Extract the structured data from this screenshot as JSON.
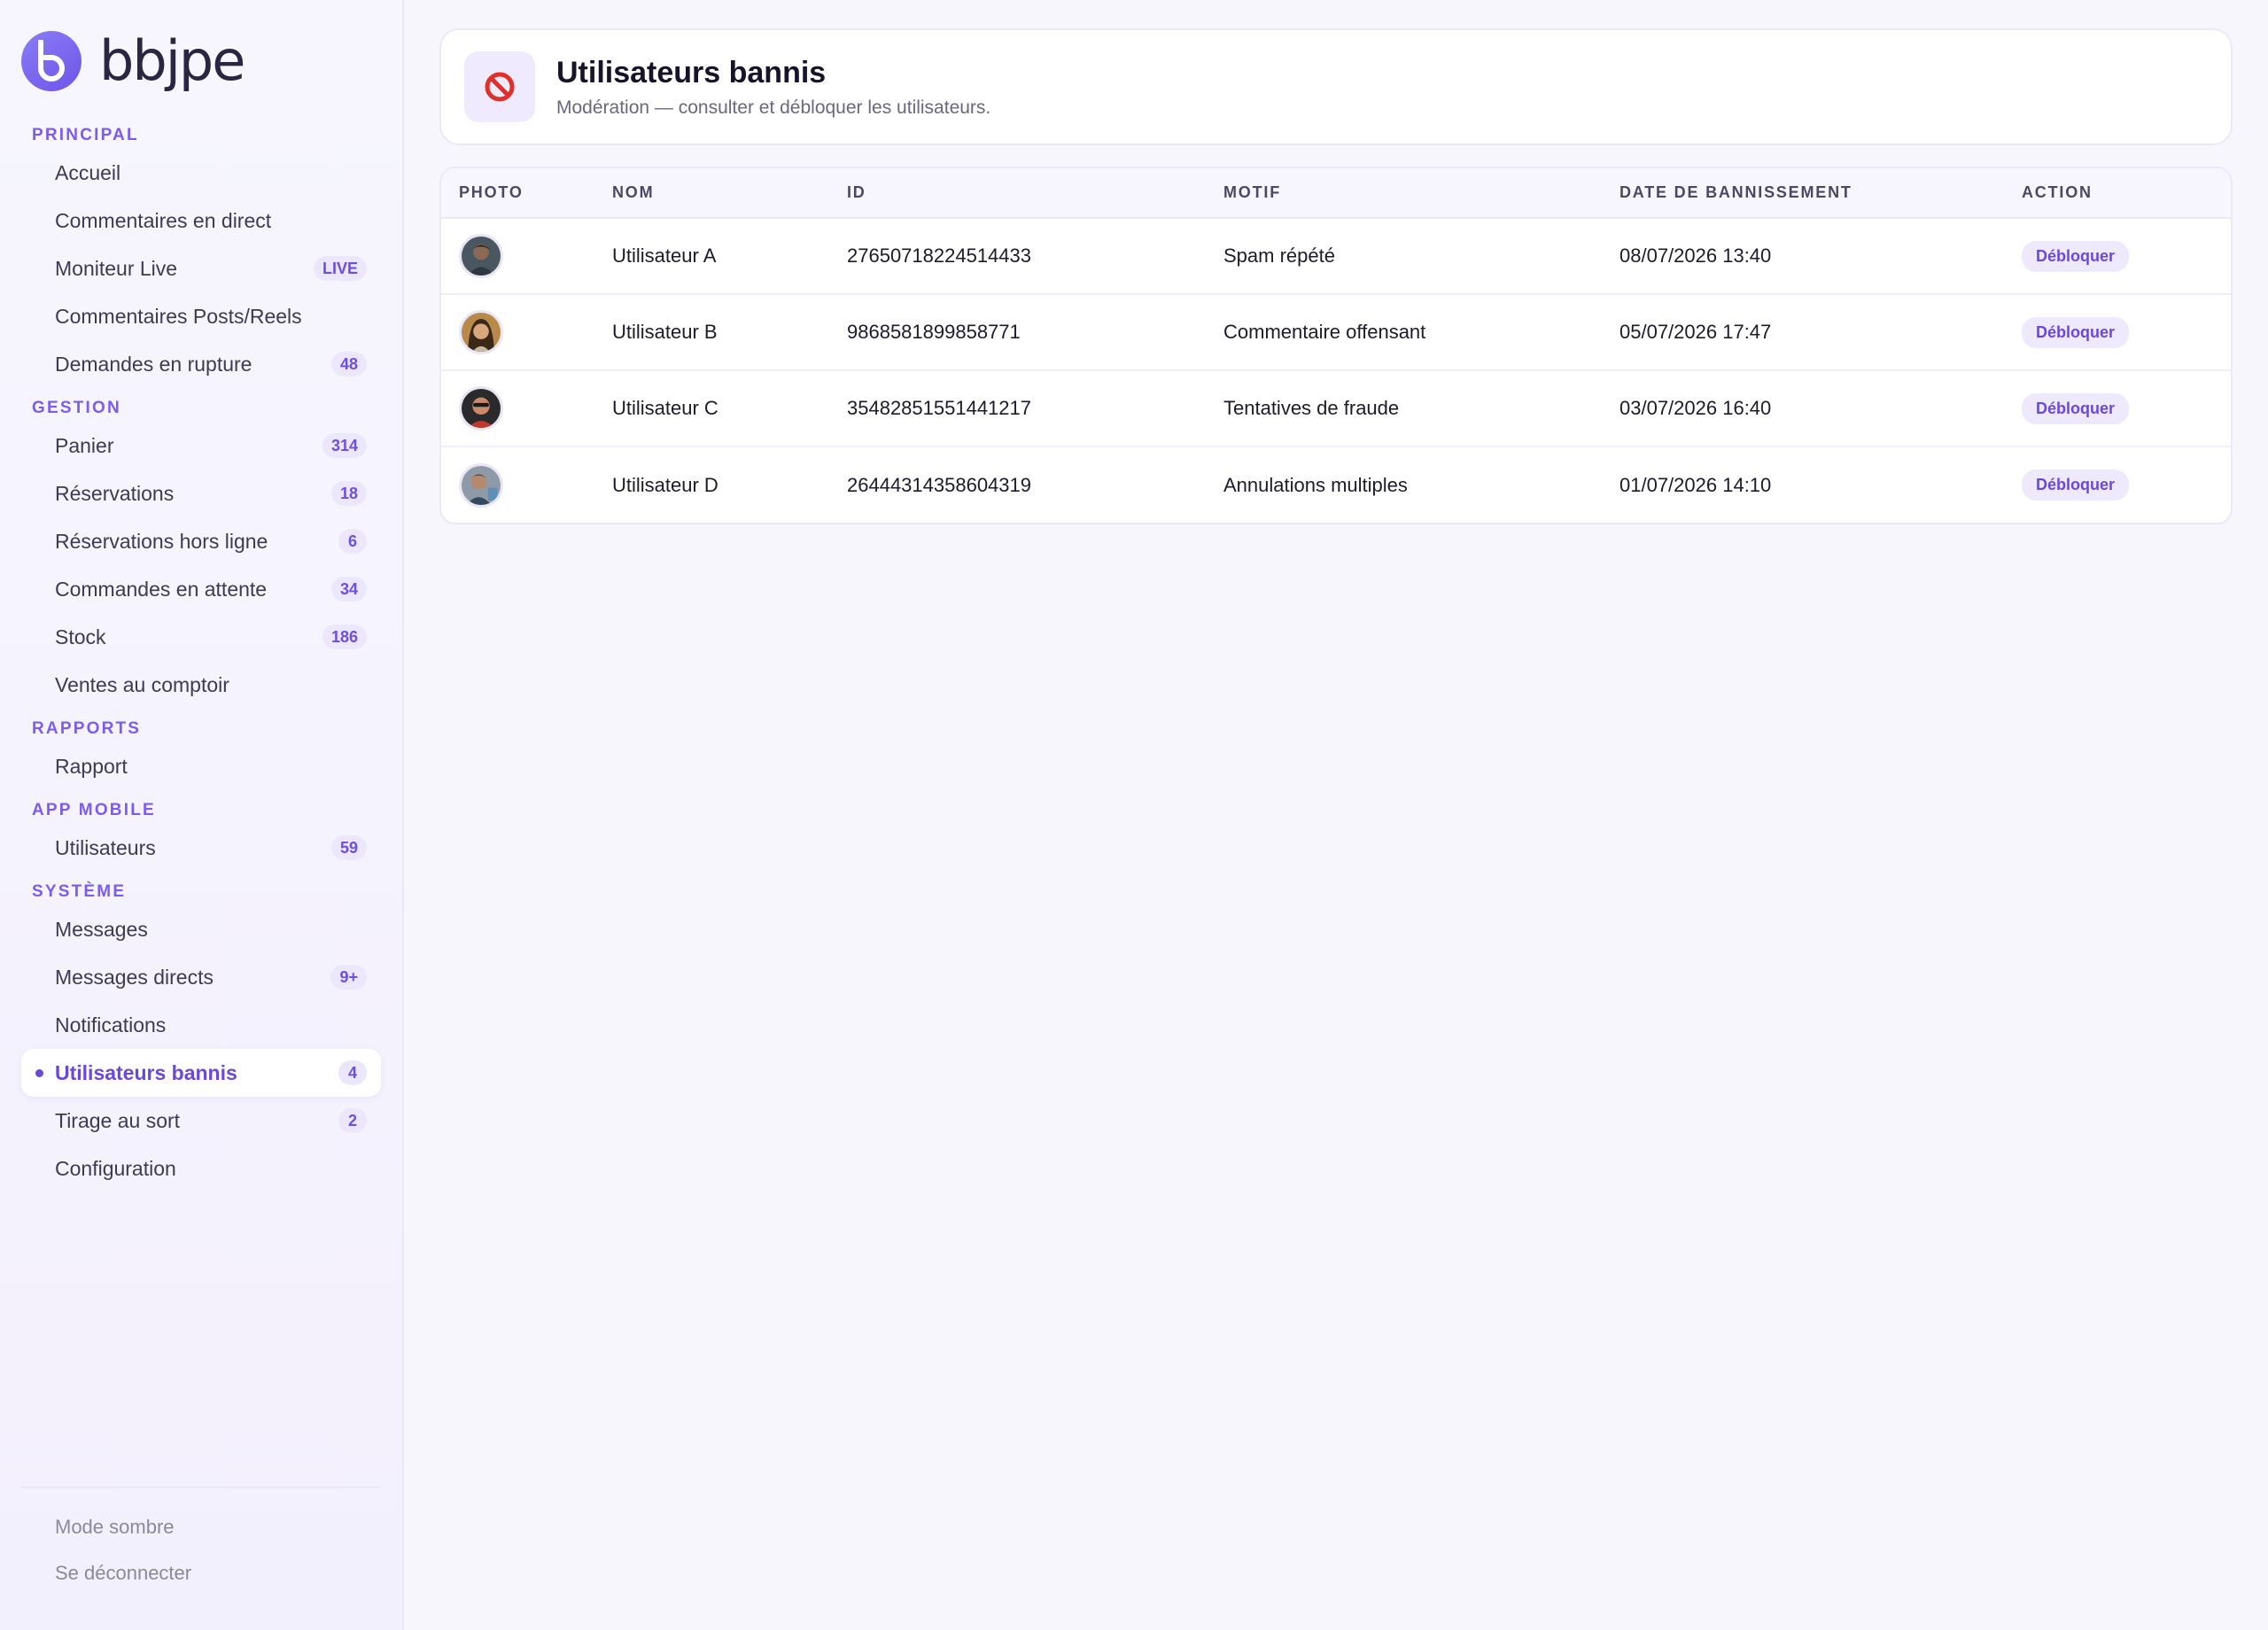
{
  "brand": {
    "name": "bbjpe",
    "accent": "#6d55e8"
  },
  "sidebar": {
    "sections": [
      {
        "title": "PRINCIPAL",
        "items": [
          {
            "label": "Accueil",
            "badge": ""
          },
          {
            "label": "Commentaires en direct",
            "badge": ""
          },
          {
            "label": "Moniteur Live",
            "badge": "LIVE"
          },
          {
            "label": "Commentaires Posts/Reels",
            "badge": ""
          },
          {
            "label": "Demandes en rupture",
            "badge": "48"
          }
        ]
      },
      {
        "title": "GESTION",
        "items": [
          {
            "label": "Panier",
            "badge": "314"
          },
          {
            "label": "Réservations",
            "badge": "18"
          },
          {
            "label": "Réservations hors ligne",
            "badge": "6"
          },
          {
            "label": "Commandes en attente",
            "badge": "34"
          },
          {
            "label": "Stock",
            "badge": "186"
          },
          {
            "label": "Ventes au comptoir",
            "badge": ""
          }
        ]
      },
      {
        "title": "RAPPORTS",
        "items": [
          {
            "label": "Rapport",
            "badge": ""
          }
        ]
      },
      {
        "title": "APP MOBILE",
        "items": [
          {
            "label": "Utilisateurs",
            "badge": "59"
          }
        ]
      },
      {
        "title": "SYSTÈME",
        "items": [
          {
            "label": "Messages",
            "badge": ""
          },
          {
            "label": "Messages directs",
            "badge": "9+"
          },
          {
            "label": "Notifications",
            "badge": ""
          },
          {
            "label": "Utilisateurs bannis",
            "badge": "4",
            "active": true
          },
          {
            "label": "Tirage au sort",
            "badge": "2"
          },
          {
            "label": "Configuration",
            "badge": ""
          }
        ]
      }
    ],
    "footer": {
      "dark_mode": "Mode sombre",
      "logout": "Se déconnecter"
    }
  },
  "header": {
    "icon": "prohibited-icon",
    "title": "Utilisateurs bannis",
    "subtitle": "Modération — consulter et débloquer les utilisateurs."
  },
  "table": {
    "columns": [
      "PHOTO",
      "NOM",
      "ID",
      "MOTIF",
      "DATE DE BANNISSEMENT",
      "ACTION"
    ],
    "rows": [
      {
        "name": "Utilisateur A",
        "id": "27650718224514433",
        "reason": "Spam répété",
        "date": "08/07/2026 13:40",
        "action": "Débloquer"
      },
      {
        "name": "Utilisateur B",
        "id": "9868581899858771",
        "reason": "Commentaire offensant",
        "date": "05/07/2026 17:47",
        "action": "Débloquer"
      },
      {
        "name": "Utilisateur C",
        "id": "35482851551441217",
        "reason": "Tentatives de fraude",
        "date": "03/07/2026 16:40",
        "action": "Débloquer"
      },
      {
        "name": "Utilisateur D",
        "id": "26444314358604319",
        "reason": "Annulations multiples",
        "date": "01/07/2026 14:10",
        "action": "Débloquer"
      }
    ]
  }
}
